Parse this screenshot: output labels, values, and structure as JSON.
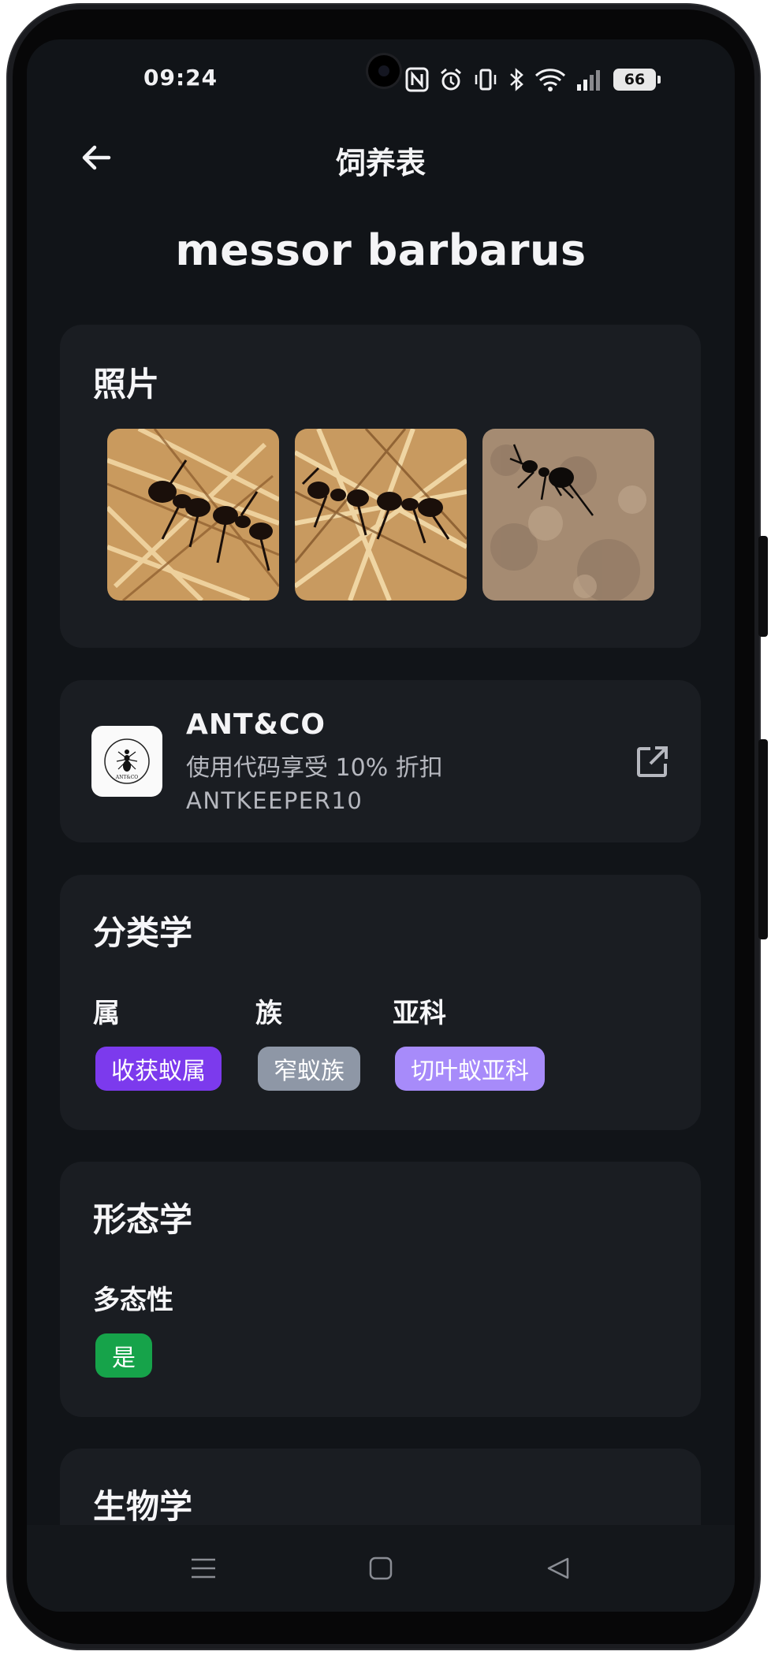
{
  "status_bar": {
    "time": "09:24",
    "battery": "66"
  },
  "header": {
    "title": "饲养表"
  },
  "species_name": "messor barbarus",
  "photos_section": {
    "title": "照片",
    "photos": [
      {
        "icon": "photo-ants-on-straw"
      },
      {
        "icon": "photo-ants-on-straw"
      },
      {
        "icon": "photo-ant-on-sand"
      }
    ]
  },
  "sponsor": {
    "name": "ANT&CO",
    "description": "使用代码享受 10% 折扣",
    "code": "ANTKEEPER10",
    "logo_text": "ANT&CO",
    "action_icon": "open-external-icon"
  },
  "taxonomy": {
    "title": "分类学",
    "fields": [
      {
        "label": "属",
        "value": "收获蚁属",
        "color": "#7c3aed"
      },
      {
        "label": "族",
        "value": "窄蚁族",
        "color": "#8e97a6"
      },
      {
        "label": "亚科",
        "value": "切叶蚁亚科",
        "color": "#a78bfa"
      }
    ]
  },
  "morphology": {
    "title": "形态学",
    "polymorphism_label": "多态性",
    "polymorphism_value": "是",
    "polymorphism_color": "#16a34a"
  },
  "biology": {
    "title": "生物学"
  },
  "nav": {
    "icons": [
      "menu-icon",
      "home-square-icon",
      "back-triangle-icon"
    ]
  },
  "colors": {
    "background": "#111418",
    "card": "#1a1d22",
    "text": "#f4f4f6",
    "muted": "#b6b8bf"
  }
}
